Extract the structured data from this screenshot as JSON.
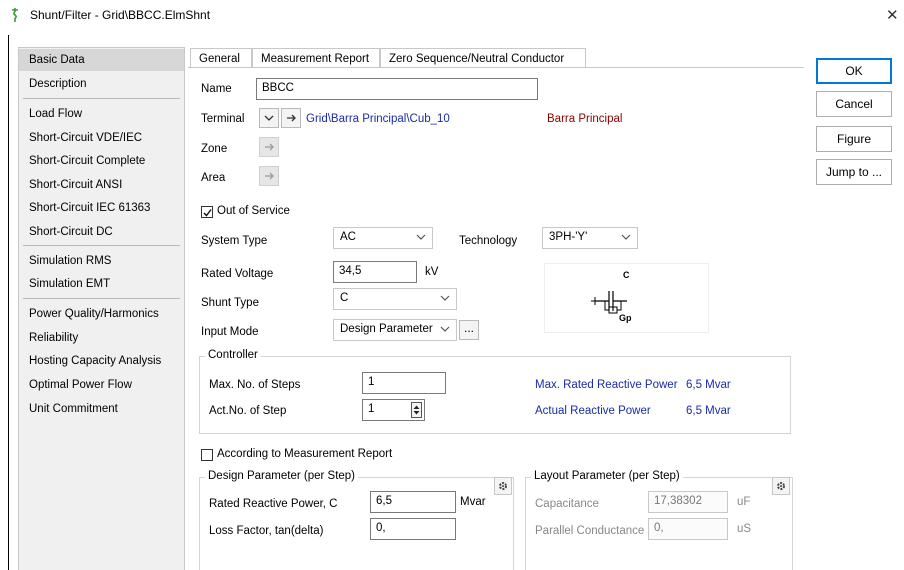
{
  "window": {
    "title": "Shunt/Filter - Grid\\BBCC.ElmShnt"
  },
  "sidebar": {
    "items": [
      {
        "label": "Basic Data"
      },
      {
        "label": "Description"
      },
      {
        "label": "Load Flow"
      },
      {
        "label": "Short-Circuit VDE/IEC"
      },
      {
        "label": "Short-Circuit Complete"
      },
      {
        "label": "Short-Circuit ANSI"
      },
      {
        "label": "Short-Circuit IEC 61363"
      },
      {
        "label": "Short-Circuit DC"
      },
      {
        "label": "Simulation RMS"
      },
      {
        "label": "Simulation EMT"
      },
      {
        "label": "Power Quality/Harmonics"
      },
      {
        "label": "Reliability"
      },
      {
        "label": "Hosting Capacity Analysis"
      },
      {
        "label": "Optimal Power Flow"
      },
      {
        "label": "Unit Commitment"
      }
    ]
  },
  "tabs": [
    {
      "label": "General"
    },
    {
      "label": "Measurement Report"
    },
    {
      "label": "Zero Sequence/Neutral Conductor"
    }
  ],
  "buttons": {
    "ok": "OK",
    "cancel": "Cancel",
    "figure": "Figure",
    "jump": "Jump to ..."
  },
  "general": {
    "name_label": "Name",
    "name_value": "BBCC",
    "terminal_label": "Terminal",
    "terminal_path": "Grid\\Barra Principal\\Cub_10",
    "terminal_bus": "Barra Principal",
    "zone_label": "Zone",
    "area_label": "Area",
    "out_of_service": "Out of Service",
    "system_type_label": "System Type",
    "system_type_value": "AC",
    "technology_label": "Technology",
    "technology_value": "3PH-'Y'",
    "rated_voltage_label": "Rated Voltage",
    "rated_voltage_value": "34,5",
    "rated_voltage_unit": "kV",
    "shunt_type_label": "Shunt Type",
    "shunt_type_value": "C",
    "input_mode_label": "Input Mode",
    "input_mode_value": "Design Parameter",
    "ellipsis": "...",
    "diagram_c": "C",
    "diagram_gp": "Gp"
  },
  "controller": {
    "title": "Controller",
    "max_steps_label": "Max. No. of Steps",
    "max_steps_value": "1",
    "act_step_label": "Act.No. of Step",
    "act_step_value": "1",
    "max_q_label": "Max. Rated Reactive Power",
    "max_q_value": "6,5 Mvar",
    "act_q_label": "Actual Reactive Power",
    "act_q_value": "6,5 Mvar"
  },
  "measurement": {
    "according_label": "According to Measurement Report"
  },
  "design": {
    "title": "Design Parameter (per Step)",
    "q_label": "Rated Reactive Power, C",
    "q_value": "6,5",
    "q_unit": "Mvar",
    "loss_label": "Loss Factor, tan(delta)",
    "loss_value": "0,"
  },
  "layout_param": {
    "title": "Layout Parameter (per Step)",
    "cap_label": "Capacitance",
    "cap_value": "17,38302",
    "cap_unit": "uF",
    "cond_label": "Parallel Conductance",
    "cond_value": "0,",
    "cond_unit": "uS"
  }
}
